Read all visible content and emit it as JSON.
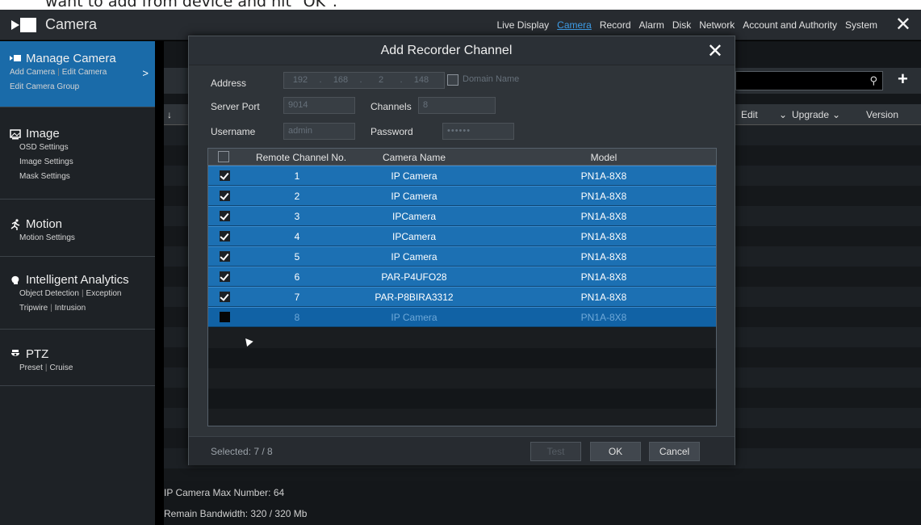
{
  "caption": "want to add from device and hit \"OK\".",
  "app": {
    "title": "Camera",
    "close_icon": "close-icon"
  },
  "topnav": [
    {
      "label": "Live Display",
      "active": false
    },
    {
      "label": "Camera",
      "active": true
    },
    {
      "label": "Record",
      "active": false
    },
    {
      "label": "Alarm",
      "active": false
    },
    {
      "label": "Disk",
      "active": false
    },
    {
      "label": "Network",
      "active": false
    },
    {
      "label": "Account and Authority",
      "active": false
    },
    {
      "label": "System",
      "active": false
    }
  ],
  "sidebar": {
    "manage": {
      "title": "Manage Camera",
      "links": [
        "Add Camera",
        "Edit Camera",
        "Edit Camera Group"
      ]
    },
    "image": {
      "title": "Image",
      "links": [
        "OSD Settings",
        "Image Settings",
        "Mask Settings"
      ]
    },
    "motion": {
      "title": "Motion",
      "links": [
        "Motion Settings"
      ]
    },
    "analytics": {
      "title": "Intelligent Analytics",
      "links": [
        "Object Detection",
        "Exception",
        "Tripwire",
        "Intrusion"
      ]
    },
    "ptz": {
      "title": "PTZ",
      "links": [
        "Preset",
        "Cruise"
      ]
    }
  },
  "main": {
    "col_edit": "Edit",
    "col_upgrade": "Upgrade",
    "col_version": "Version",
    "max_number": "IP Camera Max Number: 64",
    "bandwidth": "Remain Bandwidth: 320 / 320 Mb"
  },
  "dialog": {
    "title": "Add Recorder Channel",
    "address_label": "Address",
    "ip": [
      "192",
      "168",
      "2",
      "148"
    ],
    "domain_label": "Domain Name",
    "server_port_label": "Server Port",
    "server_port_value": "9014",
    "channels_label": "Channels",
    "channels_value": "8",
    "username_label": "Username",
    "username_value": "admin",
    "password_label": "Password",
    "password_value": "••••••",
    "headers": {
      "channel": "Remote Channel No.",
      "name": "Camera Name",
      "model": "Model"
    },
    "rows": [
      {
        "no": "1",
        "name": "IP Camera",
        "model": "PN1A-8X8",
        "checked": true
      },
      {
        "no": "2",
        "name": "IP Camera",
        "model": "PN1A-8X8",
        "checked": true
      },
      {
        "no": "3",
        "name": "IPCamera",
        "model": "PN1A-8X8",
        "checked": true
      },
      {
        "no": "4",
        "name": "IPCamera",
        "model": "PN1A-8X8",
        "checked": true
      },
      {
        "no": "5",
        "name": "IP Camera",
        "model": "PN1A-8X8",
        "checked": true
      },
      {
        "no": "6",
        "name": "PAR-P4UFO28",
        "model": "PN1A-8X8",
        "checked": true
      },
      {
        "no": "7",
        "name": "PAR-P8BIRA3312",
        "model": "PN1A-8X8",
        "checked": true
      },
      {
        "no": "8",
        "name": "IP Camera",
        "model": "PN1A-8X8",
        "checked": false
      }
    ],
    "selected": "Selected: 7 / 8",
    "test": "Test",
    "ok": "OK",
    "cancel": "Cancel"
  }
}
